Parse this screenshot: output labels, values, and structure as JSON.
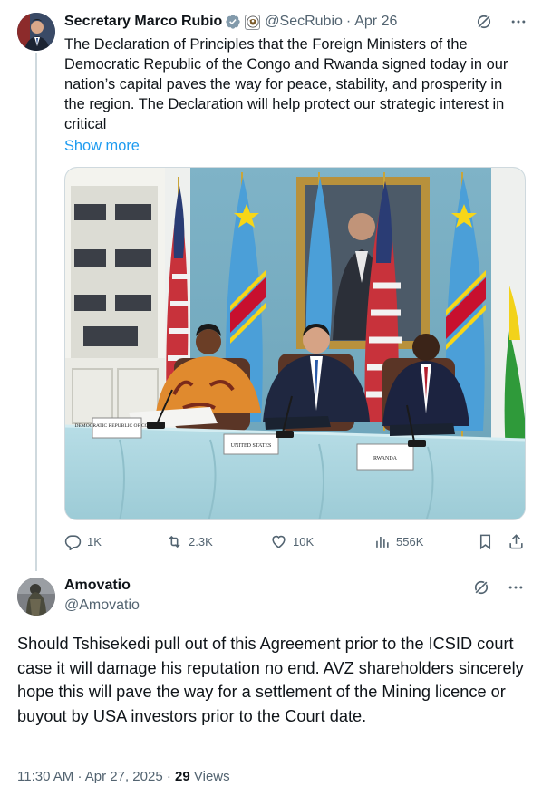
{
  "tweet1": {
    "author_name": "Secretary Marco Rubio",
    "handle": "@SecRubio",
    "separator": "·",
    "date": "Apr 26",
    "body": "The Declaration of Principles that the Foreign Ministers of the Democratic Republic of the Congo and Rwanda signed today in our nation’s capital paves the way for peace, stability, and prosperity in the region. The Declaration will help protect our strategic interest in critical",
    "show_more": "Show more",
    "photo": {
      "placard_drc": "DEMOCRATIC REPUBLIC OF CONGO",
      "placard_us": "UNITED STATES",
      "placard_rwanda": "RWANDA"
    },
    "actions": {
      "replies": "1K",
      "reposts": "2.3K",
      "likes": "10K",
      "views": "556K"
    }
  },
  "tweet2": {
    "author_name": "Amovatio",
    "handle": "@Amovatio",
    "body": "Should Tshisekedi pull out of this Agreement prior to the ICSID court case it will damage his reputation no end.  AVZ shareholders sincerely hope this will pave the way for a settlement of the Mining licence or buyout by USA investors prior to the Court date.",
    "time": "11:30 AM",
    "separator": "·",
    "date": "Apr 27, 2025",
    "separator2": "·",
    "views_count": "29",
    "views_label": "Views"
  },
  "colors": {
    "accent": "#1d9bf0",
    "muted": "#536471",
    "text": "#0f1419"
  }
}
